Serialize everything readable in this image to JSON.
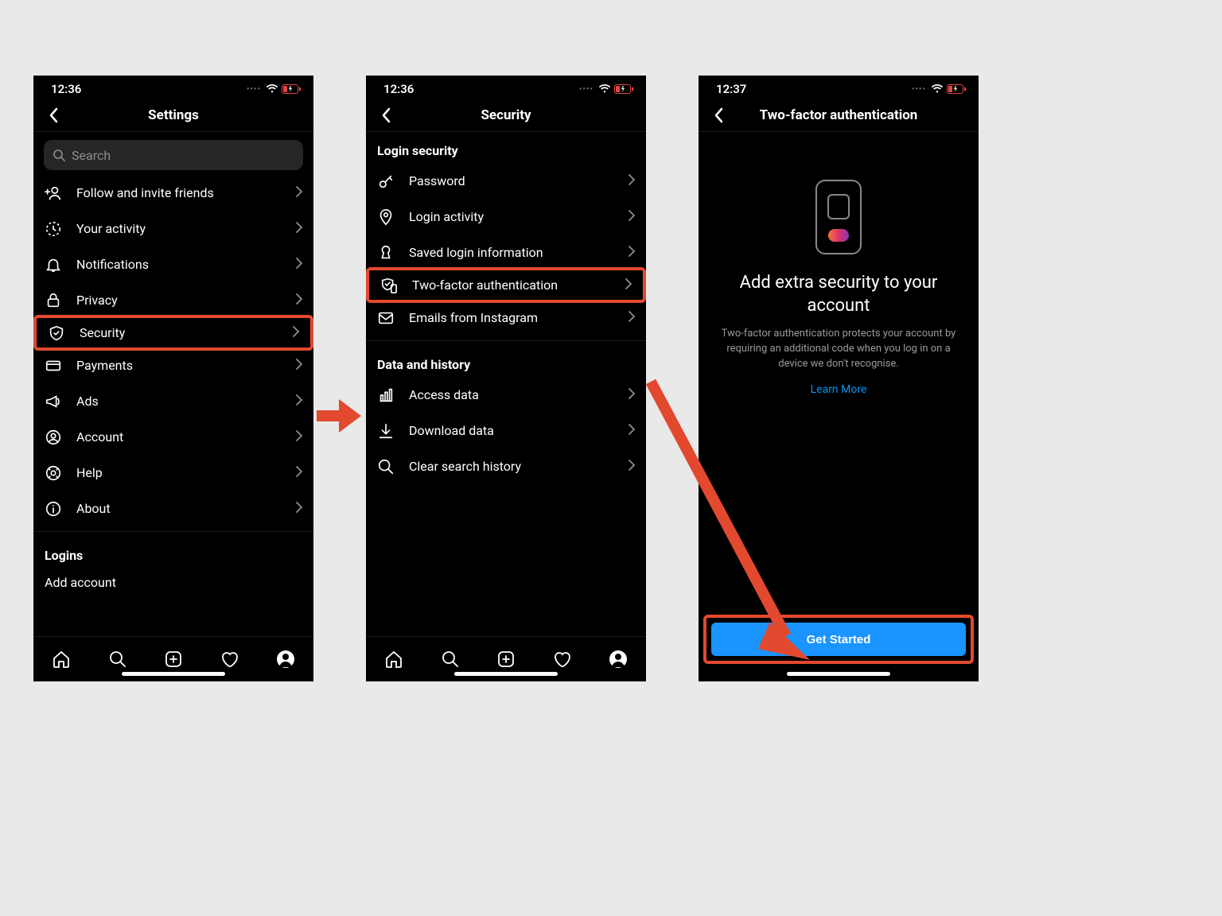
{
  "phone1": {
    "time": "12:36",
    "title": "Settings",
    "search_placeholder": "Search",
    "items": [
      {
        "icon": "person-add",
        "label": "Follow and invite friends"
      },
      {
        "icon": "clock",
        "label": "Your activity"
      },
      {
        "icon": "bell",
        "label": "Notifications"
      },
      {
        "icon": "lock",
        "label": "Privacy"
      },
      {
        "icon": "shield",
        "label": "Security",
        "highlight": true
      },
      {
        "icon": "card",
        "label": "Payments"
      },
      {
        "icon": "megaphone",
        "label": "Ads"
      },
      {
        "icon": "account",
        "label": "Account"
      },
      {
        "icon": "help",
        "label": "Help"
      },
      {
        "icon": "info",
        "label": "About"
      }
    ],
    "logins_title": "Logins",
    "add_account": "Add account"
  },
  "phone2": {
    "time": "12:36",
    "title": "Security",
    "section1": "Login security",
    "items1": [
      {
        "icon": "key",
        "label": "Password"
      },
      {
        "icon": "pin",
        "label": "Login activity"
      },
      {
        "icon": "keyhole",
        "label": "Saved login information"
      },
      {
        "icon": "shield-phone",
        "label": "Two-factor authentication",
        "highlight": true
      },
      {
        "icon": "mail",
        "label": "Emails from Instagram"
      }
    ],
    "section2": "Data and history",
    "items2": [
      {
        "icon": "bars",
        "label": "Access data"
      },
      {
        "icon": "download",
        "label": "Download data"
      },
      {
        "icon": "search",
        "label": "Clear search history"
      }
    ]
  },
  "phone3": {
    "time": "12:37",
    "title": "Two-factor authentication",
    "heading": "Add extra security to your account",
    "paragraph": "Two-factor authentication protects your account by requiring an additional code when you log in on a device we don't recognise.",
    "learn_more": "Learn More",
    "cta": "Get Started"
  }
}
